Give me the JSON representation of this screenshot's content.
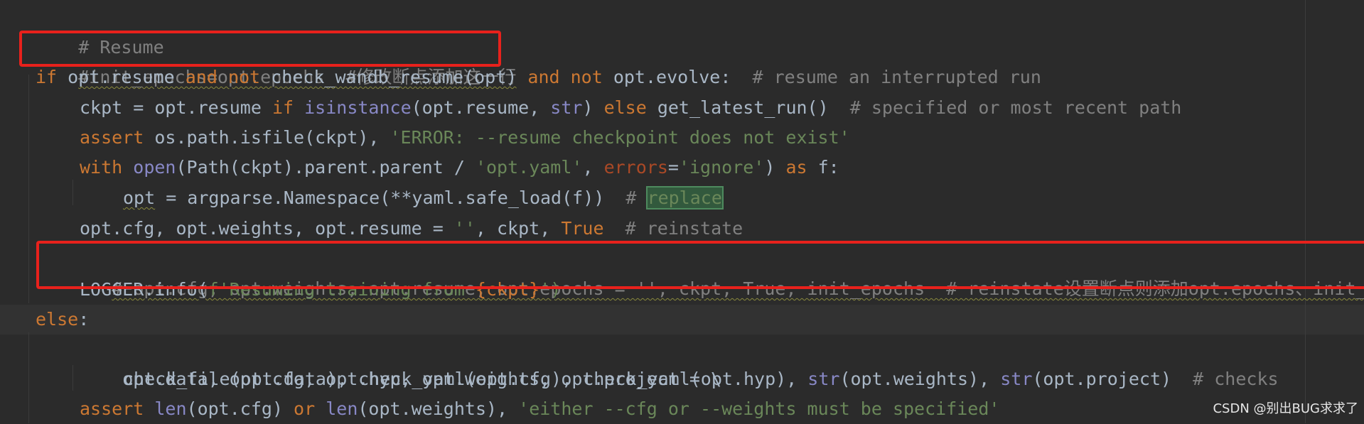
{
  "editor": {
    "lines": [
      {
        "id": "l1",
        "tokens": [
          "# Resume"
        ]
      },
      {
        "id": "l2",
        "tokens": [
          "#init_epochs=opt.epochs  #修改断点添加这一行"
        ]
      },
      {
        "id": "l3",
        "tokens": [
          "if",
          " opt.resume ",
          "and",
          " ",
          "not",
          " check_wandb_resume(opt) ",
          "and",
          " ",
          "not",
          " opt.evolve:  ",
          "# resume an interrupted run"
        ]
      },
      {
        "id": "l4",
        "tokens": [
          "ckpt = opt.resume ",
          "if",
          " ",
          "isinstance",
          "(opt.resume, ",
          "str",
          ") ",
          "else",
          " get_latest_run()  ",
          "# specified or most recent path"
        ]
      },
      {
        "id": "l5",
        "tokens": [
          "assert",
          " os.path.isfile(ckpt), ",
          "'ERROR: --resume checkpoint does not exist'"
        ]
      },
      {
        "id": "l6",
        "tokens": [
          "with",
          " ",
          "open",
          "(Path(ckpt).parent.parent / ",
          "'opt.yaml'",
          ", ",
          "errors",
          "=",
          "'ignore'",
          ") ",
          "as",
          " f:"
        ]
      },
      {
        "id": "l7",
        "tokens": [
          "opt",
          " = argparse.Namespace(**yaml.safe_load(f))  ",
          "# ",
          "replace"
        ]
      },
      {
        "id": "l8",
        "tokens": [
          "opt.cfg, opt.weights, opt.resume = ",
          "''",
          ", ckpt, ",
          "True",
          "  ",
          "# reinstate"
        ]
      },
      {
        "id": "l9",
        "tokens": [
          "# opt.cfg, opt.weights, opt.resume, opt.epochs = '', ckpt, True, init_epochs  # reinstate设置断点则添加opt.epochs、init_epochs"
        ]
      },
      {
        "id": "l10",
        "tokens": [
          "LOGGER.info(",
          "f'Resuming training from ",
          "{ckpt}",
          "')"
        ]
      },
      {
        "id": "l11",
        "tokens": [
          "else",
          ":"
        ]
      },
      {
        "id": "l12",
        "tokens": [
          "opt.data, opt.cfg, opt.hyp, opt.weights, opt.project = \\"
        ]
      },
      {
        "id": "l13",
        "tokens": [
          "check_file(opt.data), check_yaml(opt.cfg), check_yaml(opt.hyp), ",
          "str",
          "(opt.weights), ",
          "str",
          "(opt.project)  ",
          "# checks"
        ]
      },
      {
        "id": "l14",
        "tokens": [
          "assert",
          " ",
          "len",
          "(opt.cfg) ",
          "or",
          " ",
          "len",
          "(opt.weights), ",
          "'either --cfg or --weights must be specified'"
        ]
      }
    ]
  },
  "watermark": "CSDN @别出BUG求求了"
}
